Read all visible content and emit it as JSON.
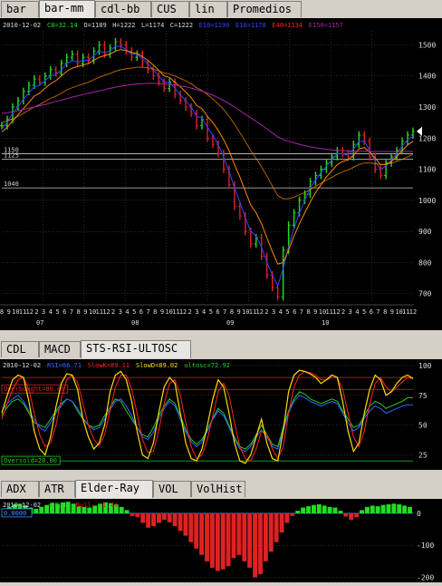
{
  "panels": [
    {
      "tabs": [
        "bar",
        "bar-mm",
        "cdl-bb",
        "CUS",
        "lin",
        "Promedios"
      ],
      "active_tab": 1
    },
    {
      "tabs": [
        "CDL",
        "MACD",
        "STS-RSI-ULTOSC"
      ],
      "active_tab": 2
    },
    {
      "tabs": [
        "ADX",
        "ATR",
        "Elder-Ray",
        "VOL",
        "VolHist"
      ],
      "active_tab": 2
    }
  ],
  "colors": {
    "background": "#000000",
    "grid": "#444444",
    "up_bar": "#22dd22",
    "down_bar": "#dd2222",
    "ma_short": "#3344ff",
    "ma_mid": "#ff8800",
    "ma_long": "#aa22aa",
    "stoch_k": "#ffdd00",
    "stoch_d": "#ff2222",
    "rsi": "#3366ff",
    "ultosc": "#22cc22"
  },
  "chart_data": [
    {
      "type": "line",
      "title_row": [
        "2010-12-02",
        "C8=32.14",
        "O=1189",
        "H=1222",
        "L=1174",
        "C=1222",
        "E10=1190",
        "E18=1178",
        "E40=1134",
        "E150=1157"
      ],
      "x_day_labels": [
        "8",
        "9",
        "10",
        "11",
        "12",
        "2",
        "3",
        "4",
        "5",
        "6",
        "7",
        "8",
        "9",
        "10",
        "11",
        "12",
        "2",
        "3",
        "4",
        "5",
        "6",
        "7",
        "8",
        "9",
        "10",
        "11",
        "12",
        "2",
        "3",
        "4",
        "5",
        "6",
        "7",
        "8",
        "9",
        "10",
        "11",
        "12",
        "2",
        "3",
        "4",
        "5",
        "6",
        "7",
        "8",
        "9",
        "10",
        "11",
        "12",
        "2",
        "3",
        "4",
        "5",
        "6",
        "7",
        "8",
        "9",
        "10",
        "11",
        "12"
      ],
      "x_month_labels": [
        "07",
        "08",
        "09",
        "10"
      ],
      "y_ticks": [
        700,
        800,
        900,
        1000,
        1100,
        1200,
        1300,
        1400,
        1500
      ],
      "ylim": [
        670,
        1545
      ],
      "grid": true,
      "hlines": [
        {
          "label": "1150",
          "value": 1150
        },
        {
          "label": "1125",
          "value": 1132
        },
        {
          "label": "1040",
          "value": 1040
        }
      ],
      "series": [
        {
          "name": "price",
          "values": [
            1240,
            1260,
            1300,
            1320,
            1350,
            1370,
            1390,
            1380,
            1400,
            1420,
            1410,
            1440,
            1460,
            1470,
            1440,
            1460,
            1450,
            1480,
            1500,
            1470,
            1490,
            1510,
            1500,
            1480,
            1460,
            1470,
            1440,
            1420,
            1400,
            1380,
            1360,
            1380,
            1340,
            1320,
            1300,
            1280,
            1240,
            1260,
            1200,
            1180,
            1150,
            1100,
            1050,
            980,
            950,
            900,
            860,
            880,
            820,
            760,
            720,
            690,
            840,
            920,
            960,
            1000,
            1020,
            1060,
            1080,
            1100,
            1120,
            1140,
            1160,
            1150,
            1140,
            1180,
            1210,
            1190,
            1140,
            1100,
            1080,
            1120,
            1140,
            1160,
            1190,
            1210,
            1222
          ]
        },
        {
          "name": "E10",
          "values": [
            1230,
            1250,
            1280,
            1300,
            1325,
            1345,
            1365,
            1370,
            1385,
            1400,
            1405,
            1420,
            1440,
            1450,
            1445,
            1450,
            1450,
            1465,
            1480,
            1475,
            1480,
            1495,
            1495,
            1485,
            1470,
            1470,
            1455,
            1440,
            1420,
            1400,
            1380,
            1380,
            1360,
            1340,
            1320,
            1300,
            1270,
            1265,
            1235,
            1210,
            1180,
            1140,
            1095,
            1040,
            995,
            945,
            900,
            885,
            850,
            800,
            760,
            725,
            780,
            850,
            910,
            960,
            1000,
            1040,
            1065,
            1090,
            1110,
            1130,
            1150,
            1150,
            1145,
            1165,
            1190,
            1190,
            1160,
            1125,
            1100,
            1110,
            1130,
            1150,
            1175,
            1195,
            1205
          ]
        },
        {
          "name": "E18",
          "values": [
            1220,
            1235,
            1255,
            1275,
            1295,
            1315,
            1335,
            1345,
            1360,
            1375,
            1385,
            1400,
            1415,
            1425,
            1430,
            1435,
            1440,
            1450,
            1460,
            1465,
            1470,
            1480,
            1485,
            1482,
            1475,
            1472,
            1462,
            1450,
            1435,
            1418,
            1400,
            1395,
            1380,
            1365,
            1348,
            1330,
            1305,
            1295,
            1270,
            1250,
            1225,
            1195,
            1160,
            1115,
            1075,
            1030,
            985,
            960,
            925,
            880,
            835,
            795,
            800,
            840,
            885,
            925,
            960,
            995,
            1025,
            1050,
            1075,
            1095,
            1115,
            1125,
            1130,
            1145,
            1165,
            1170,
            1155,
            1135,
            1115,
            1115,
            1125,
            1140,
            1160,
            1178,
            1190
          ]
        },
        {
          "name": "E40",
          "values": [
            1250,
            1255,
            1262,
            1270,
            1280,
            1290,
            1300,
            1308,
            1318,
            1328,
            1335,
            1345,
            1355,
            1362,
            1368,
            1374,
            1380,
            1388,
            1396,
            1402,
            1408,
            1415,
            1420,
            1423,
            1425,
            1428,
            1428,
            1426,
            1422,
            1416,
            1410,
            1406,
            1400,
            1392,
            1384,
            1375,
            1362,
            1353,
            1340,
            1326,
            1310,
            1292,
            1270,
            1245,
            1218,
            1190,
            1160,
            1135,
            1108,
            1078,
            1046,
            1015,
            1005,
            1005,
            1010,
            1018,
            1025,
            1035,
            1045,
            1055,
            1065,
            1074,
            1084,
            1092,
            1098,
            1106,
            1115,
            1120,
            1120,
            1118,
            1115,
            1116,
            1120,
            1125,
            1132,
            1140,
            1148
          ]
        },
        {
          "name": "E150",
          "values": [
            1280,
            1282,
            1285,
            1288,
            1292,
            1296,
            1300,
            1304,
            1308,
            1313,
            1318,
            1322,
            1327,
            1332,
            1336,
            1340,
            1344,
            1348,
            1352,
            1356,
            1360,
            1364,
            1367,
            1370,
            1372,
            1374,
            1375,
            1376,
            1376,
            1375,
            1374,
            1373,
            1371,
            1368,
            1365,
            1361,
            1356,
            1351,
            1345,
            1338,
            1330,
            1321,
            1311,
            1300,
            1289,
            1277,
            1265,
            1254,
            1242,
            1230,
            1217,
            1204,
            1196,
            1190,
            1185,
            1180,
            1176,
            1172,
            1169,
            1166,
            1164,
            1162,
            1161,
            1160,
            1159,
            1158,
            1158,
            1158,
            1157,
            1157,
            1157,
            1157,
            1157,
            1157,
            1157,
            1157,
            1157
          ]
        }
      ]
    },
    {
      "type": "line",
      "title_row": [
        "2010-12-02",
        "RSI=66.71",
        "SlowK=89.11",
        "SlowD=89.02",
        "ultosc=72.92"
      ],
      "y_ticks": [
        25,
        50,
        75,
        100
      ],
      "ylim": [
        14,
        103
      ],
      "grid": true,
      "hlines": [
        {
          "label": "Overbought=80.00",
          "value": 80
        },
        {
          "label": "Oversold=20.00",
          "value": 20
        },
        {
          "label": "",
          "value": 90
        }
      ],
      "series": [
        {
          "name": "SlowK",
          "values": [
            60,
            75,
            88,
            92,
            90,
            70,
            45,
            30,
            25,
            40,
            65,
            85,
            93,
            92,
            80,
            55,
            40,
            30,
            35,
            50,
            78,
            92,
            95,
            88,
            70,
            45,
            25,
            22,
            35,
            60,
            82,
            90,
            85,
            60,
            35,
            22,
            20,
            30,
            50,
            72,
            88,
            82,
            60,
            35,
            20,
            18,
            25,
            40,
            55,
            35,
            22,
            20,
            45,
            78,
            92,
            96,
            95,
            93,
            90,
            85,
            88,
            92,
            90,
            70,
            45,
            28,
            35,
            60,
            80,
            92,
            88,
            75,
            78,
            85,
            90,
            92,
            89
          ]
        },
        {
          "name": "SlowD",
          "values": [
            55,
            68,
            80,
            88,
            90,
            80,
            60,
            42,
            32,
            35,
            50,
            72,
            88,
            92,
            86,
            68,
            50,
            38,
            33,
            42,
            62,
            82,
            92,
            92,
            80,
            60,
            38,
            27,
            28,
            45,
            68,
            85,
            88,
            75,
            52,
            32,
            22,
            25,
            38,
            58,
            78,
            85,
            75,
            52,
            32,
            22,
            20,
            30,
            45,
            42,
            30,
            22,
            32,
            60,
            82,
            92,
            95,
            94,
            92,
            88,
            88,
            90,
            90,
            80,
            60,
            40,
            32,
            45,
            68,
            85,
            90,
            82,
            78,
            82,
            86,
            90,
            89
          ]
        },
        {
          "name": "RSI",
          "values": [
            62,
            68,
            72,
            75,
            70,
            62,
            55,
            48,
            45,
            52,
            60,
            66,
            72,
            70,
            64,
            56,
            50,
            46,
            48,
            55,
            63,
            70,
            72,
            66,
            58,
            48,
            40,
            38,
            44,
            55,
            64,
            70,
            66,
            55,
            44,
            36,
            32,
            36,
            45,
            55,
            62,
            58,
            48,
            38,
            30,
            28,
            32,
            40,
            46,
            40,
            32,
            30,
            45,
            60,
            70,
            75,
            73,
            70,
            68,
            66,
            68,
            70,
            68,
            60,
            52,
            45,
            48,
            56,
            62,
            66,
            64,
            60,
            62,
            64,
            66,
            67,
            67
          ]
        },
        {
          "name": "ultosc",
          "values": [
            58,
            65,
            70,
            72,
            68,
            60,
            52,
            50,
            48,
            55,
            62,
            68,
            72,
            70,
            62,
            55,
            50,
            48,
            50,
            58,
            65,
            72,
            70,
            62,
            55,
            48,
            42,
            40,
            48,
            58,
            66,
            72,
            68,
            58,
            46,
            38,
            34,
            38,
            46,
            56,
            64,
            60,
            50,
            40,
            32,
            30,
            34,
            42,
            50,
            42,
            34,
            32,
            48,
            62,
            72,
            78,
            76,
            72,
            70,
            68,
            70,
            72,
            70,
            62,
            55,
            48,
            50,
            58,
            66,
            70,
            68,
            64,
            66,
            68,
            70,
            73,
            73
          ]
        }
      ]
    },
    {
      "type": "bar",
      "title_row": [
        "2010-12-02",
        "-36.46",
        "Bull: -1.44"
      ],
      "baseline_label": "0.0000",
      "y_ticks": [
        0,
        -100,
        -200
      ],
      "ylim": [
        -210,
        45
      ],
      "grid": true,
      "series": [
        {
          "name": "bull",
          "values": [
            12,
            20,
            28,
            30,
            25,
            18,
            14,
            20,
            26,
            32,
            30,
            34,
            36,
            30,
            22,
            20,
            18,
            24,
            30,
            34,
            32,
            28,
            20,
            10,
            -8,
            -12,
            -30,
            -45,
            -40,
            -30,
            -20,
            -28,
            -40,
            -55,
            -70,
            -90,
            -110,
            -130,
            -150,
            -170,
            -180,
            -175,
            -165,
            -140,
            -130,
            -150,
            -170,
            -200,
            -190,
            -150,
            -120,
            -90,
            -60,
            -30,
            -8,
            8,
            18,
            22,
            26,
            28,
            24,
            20,
            18,
            8,
            -10,
            -20,
            -12,
            10,
            20,
            24,
            22,
            26,
            28,
            30,
            28,
            24,
            20
          ]
        }
      ]
    }
  ]
}
